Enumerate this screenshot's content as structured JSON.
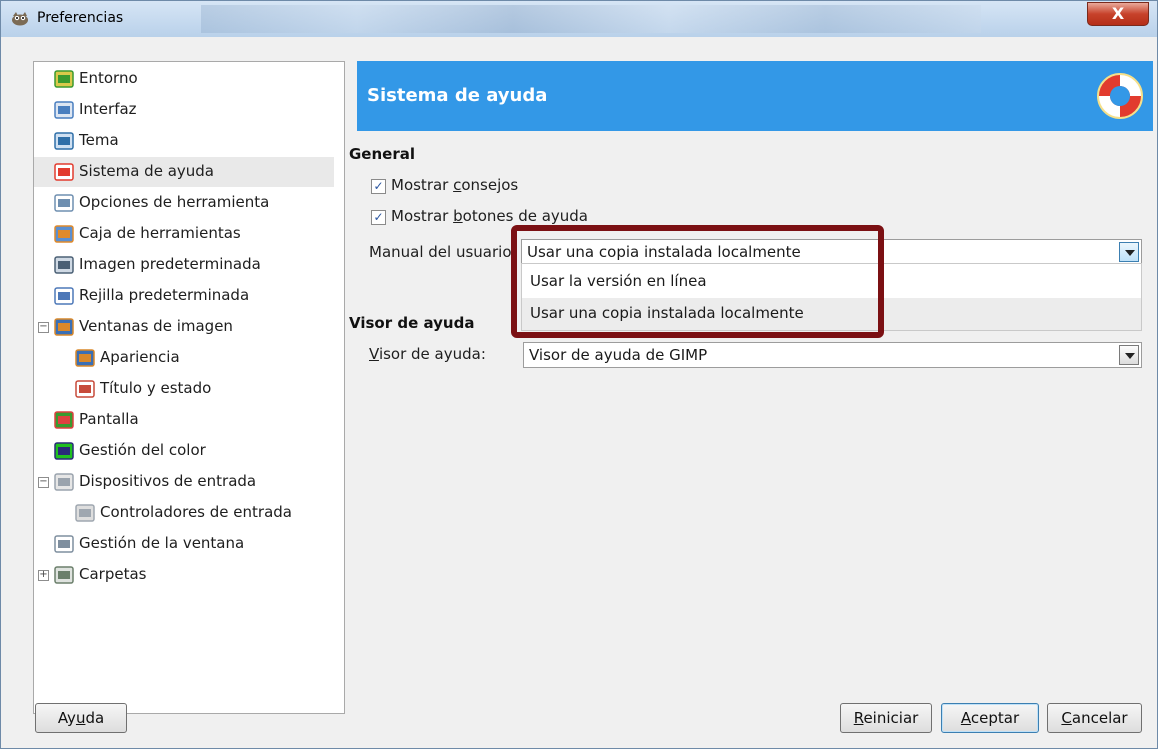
{
  "window": {
    "title": "Preferencias",
    "close_label": "X"
  },
  "nav": {
    "items": [
      {
        "label": "Entorno",
        "icon": "environment-icon"
      },
      {
        "label": "Interfaz",
        "icon": "interface-icon"
      },
      {
        "label": "Tema",
        "icon": "theme-icon"
      },
      {
        "label": "Sistema de ayuda",
        "icon": "help-system-icon",
        "selected": true
      },
      {
        "label": "Opciones de herramienta",
        "icon": "tool-options-icon"
      },
      {
        "label": "Caja de herramientas",
        "icon": "toolbox-icon"
      },
      {
        "label": "Imagen predeterminada",
        "icon": "default-image-icon"
      },
      {
        "label": "Rejilla predeterminada",
        "icon": "default-grid-icon"
      },
      {
        "label": "Ventanas de imagen",
        "icon": "image-windows-icon",
        "expander": "−"
      },
      {
        "label": "Apariencia",
        "icon": "appearance-icon"
      },
      {
        "label": "Título y estado",
        "icon": "title-status-icon"
      },
      {
        "label": "Pantalla",
        "icon": "display-icon"
      },
      {
        "label": "Gestión del color",
        "icon": "color-management-icon"
      },
      {
        "label": "Dispositivos de entrada",
        "icon": "input-devices-icon",
        "expander": "−"
      },
      {
        "label": "Controladores de entrada",
        "icon": "input-controllers-icon"
      },
      {
        "label": "Gestión de la ventana",
        "icon": "window-management-icon"
      },
      {
        "label": "Carpetas",
        "icon": "folders-icon",
        "expander": "+"
      }
    ]
  },
  "panel": {
    "title": "Sistema de ayuda",
    "general": {
      "heading": "General",
      "show_tips": {
        "pre": "Mostrar ",
        "mnemonic": "c",
        "post": "onsejos",
        "checked": true
      },
      "show_help_buttons": {
        "pre": "Mostrar ",
        "mnemonic": "b",
        "post": "otones de ayuda",
        "checked": true
      },
      "user_manual": {
        "label": "Manual del usuario:",
        "value": "Usar una copia instalada localmente",
        "options": [
          "Usar la versión en línea",
          "Usar una copia instalada localmente"
        ],
        "hovered_index": 1
      }
    },
    "help_browser": {
      "heading": "Visor de ayuda",
      "label_mnemonic": "V",
      "label_rest": "isor de ayuda:",
      "value": "Visor de ayuda de GIMP"
    }
  },
  "buttons": {
    "help": {
      "pre": "Ay",
      "mnemonic": "u",
      "post": "da"
    },
    "reset": {
      "pre": "",
      "mnemonic": "R",
      "post": "einiciar"
    },
    "ok": {
      "pre": "",
      "mnemonic": "A",
      "post": "ceptar"
    },
    "cancel": {
      "pre": "",
      "mnemonic": "C",
      "post": "ancelar"
    }
  },
  "colors": {
    "banner": "#3398e7",
    "highlight_box": "#7b1013"
  }
}
